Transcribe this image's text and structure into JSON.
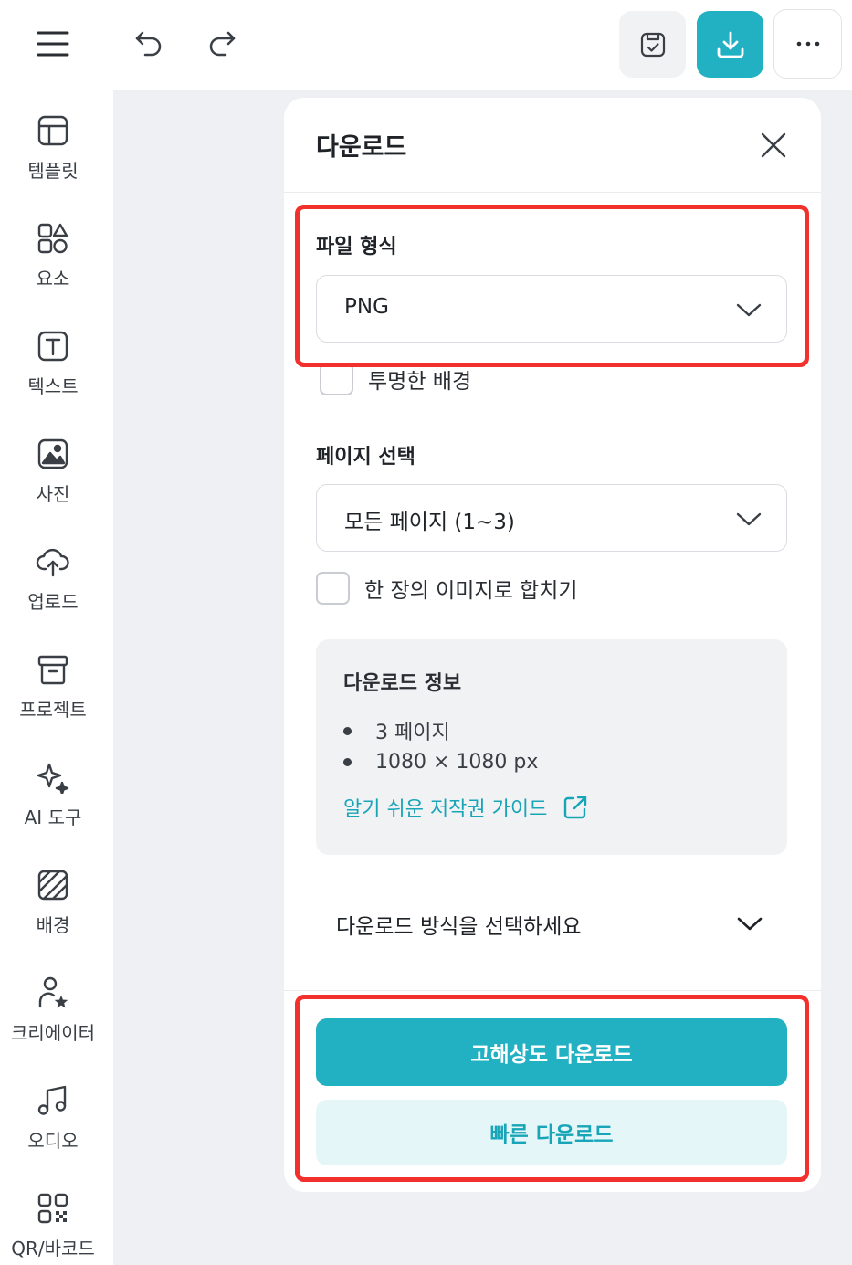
{
  "topbar": {
    "menu_icon": "hamburger-menu-icon",
    "undo_icon": "undo-icon",
    "redo_icon": "redo-icon",
    "save_icon": "save-icon",
    "download_icon": "download-icon",
    "more_icon": "more-horizontal-icon",
    "accent_color": "#22b0c3"
  },
  "sidebar": {
    "items": [
      {
        "label": "템플릿",
        "icon": "template-icon"
      },
      {
        "label": "요소",
        "icon": "elements-icon"
      },
      {
        "label": "텍스트",
        "icon": "text-icon"
      },
      {
        "label": "사진",
        "icon": "photo-icon"
      },
      {
        "label": "업로드",
        "icon": "cloud-upload-icon"
      },
      {
        "label": "프로젝트",
        "icon": "archive-icon"
      },
      {
        "label": "AI 도구",
        "icon": "sparkle-icon"
      },
      {
        "label": "배경",
        "icon": "background-icon"
      },
      {
        "label": "크리에이터",
        "icon": "creator-icon"
      },
      {
        "label": "오디오",
        "icon": "music-icon"
      },
      {
        "label": "QR/바코드",
        "icon": "qr-code-icon"
      }
    ]
  },
  "panel": {
    "title": "다운로드",
    "close_icon": "close-icon",
    "file_format": {
      "label": "파일 형식",
      "value": "PNG"
    },
    "transparent_bg": {
      "label": "투명한 배경",
      "checked": false
    },
    "page_select": {
      "label": "페이지 선택",
      "value": "모든 페이지 (1~3)"
    },
    "merge_image": {
      "label": "한 장의 이미지로 합치기",
      "checked": false
    },
    "info": {
      "title": "다운로드 정보",
      "items": [
        "3 페이지",
        "1080 × 1080 px"
      ],
      "guide_link": "알기 쉬운 저작권 가이드",
      "link_icon": "external-link-icon"
    },
    "method": {
      "label": "다운로드 방식을 선택하세요"
    },
    "buttons": {
      "primary": "고해상도 다운로드",
      "secondary": "빠른 다운로드"
    }
  },
  "highlight_color": "#f2302c"
}
